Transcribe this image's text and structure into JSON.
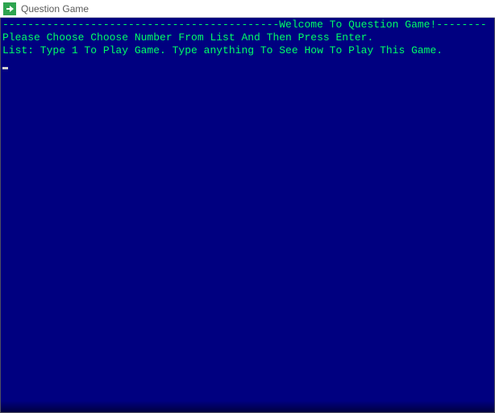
{
  "window": {
    "title": "Question Game",
    "icon": "arrow-right-icon"
  },
  "console": {
    "line1": "--------------------------------------------Welcome To Question Game!--------",
    "line2": "Please Choose Choose Number From List And Then Press Enter.",
    "line3": "List: Type 1 To Play Game. Type anything To See How To Play This Game.",
    "input_value": ""
  },
  "colors": {
    "console_bg": "#000080",
    "console_fg": "#00ff66",
    "titlebar_bg": "#ffffff",
    "icon_bg": "#2ea44f"
  }
}
